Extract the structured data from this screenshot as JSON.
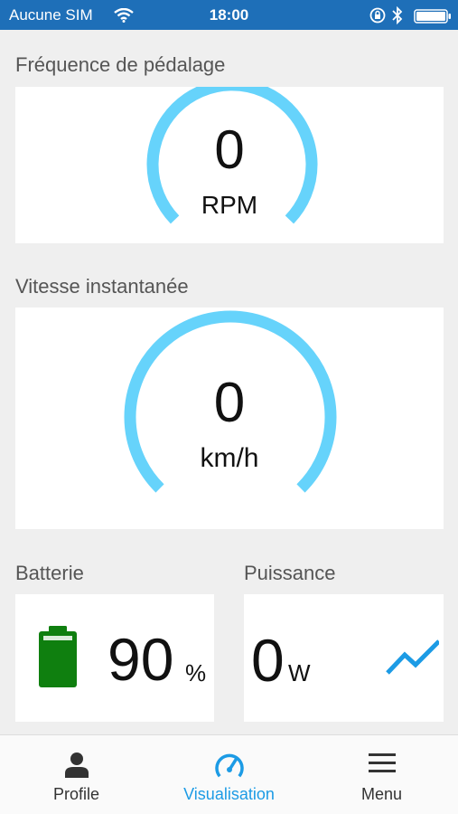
{
  "status_bar": {
    "carrier": "Aucune SIM",
    "time": "18:00"
  },
  "cadence": {
    "label": "Fréquence de pédalage",
    "value": "0",
    "unit": "RPM"
  },
  "speed": {
    "label": "Vitesse instantanée",
    "value": "0",
    "unit": "km/h"
  },
  "battery": {
    "label": "Batterie",
    "value": "90",
    "unit": "%",
    "level": 0.9
  },
  "power": {
    "label": "Puissance",
    "value": "0",
    "unit": "W"
  },
  "tabs": [
    {
      "label": "Profile",
      "icon": "person-icon",
      "active": false
    },
    {
      "label": "Visualisation",
      "icon": "speedometer-icon",
      "active": true
    },
    {
      "label": "Menu",
      "icon": "hamburger-icon",
      "active": false
    }
  ],
  "colors": {
    "header": "#1e6fb8",
    "gauge": "#66d3fb",
    "active_tab": "#1c9be5",
    "inactive_tab": "#333333",
    "battery": "#0f7f0f"
  }
}
